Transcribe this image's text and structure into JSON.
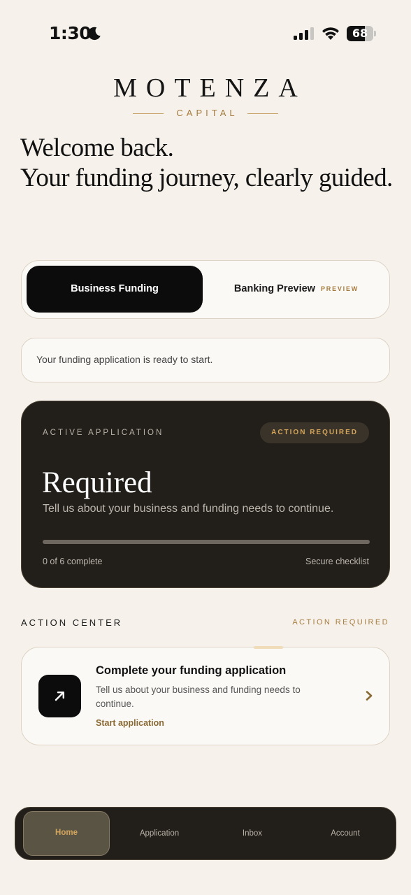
{
  "status_bar": {
    "time": "1:30",
    "battery_level": "68",
    "battery_percent": 68,
    "icons": [
      "moon-icon",
      "signal-icon",
      "wifi-icon",
      "battery-icon"
    ]
  },
  "brand": {
    "name": "MOTENZA",
    "subtitle": "CAPITAL",
    "accent_color": "#a57c3f"
  },
  "headline": {
    "line1": "Welcome back.",
    "line2": "Your funding journey, clearly guided."
  },
  "segmented": {
    "active_label": "Business Funding",
    "inactive_label": "Banking Preview",
    "inactive_badge": "PREVIEW"
  },
  "notice": {
    "text": "Your funding application is ready to start."
  },
  "application_card": {
    "eyebrow": "ACTIVE APPLICATION",
    "badge": "ACTION REQUIRED",
    "title": "Required",
    "description": "Tell us about your business and funding needs to continue.",
    "progress_fraction": 0,
    "progress_text": "0 of 6 complete",
    "secure_text": "Secure checklist",
    "background_color": "#221f1b"
  },
  "action_center": {
    "title": "ACTION CENTER",
    "action_label": "ACTION REQUIRED",
    "card": {
      "icon": "arrow-up-right-icon",
      "title": "Complete your funding application",
      "description": "Tell us about your business and funding needs to continue.",
      "link": "Start application"
    }
  },
  "tabbar": {
    "tabs": [
      {
        "label": "Home",
        "active": true
      },
      {
        "label": "Application",
        "active": false
      },
      {
        "label": "Inbox",
        "active": false
      },
      {
        "label": "Account",
        "active": false
      }
    ]
  }
}
